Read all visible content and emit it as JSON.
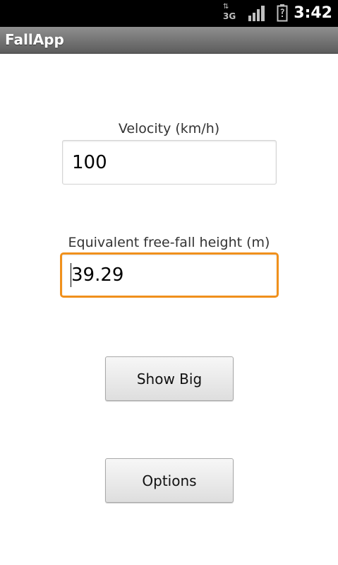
{
  "status_bar": {
    "network_type": "3G",
    "network_activity_arrows": "⇅",
    "signal_icon": "signal-bars-icon",
    "battery_icon": "battery-charging-icon",
    "time": "3:42"
  },
  "app": {
    "title": "FallApp"
  },
  "velocity": {
    "label": "Velocity (km/h)",
    "value": "100"
  },
  "height": {
    "label": "Equivalent free-fall height (m)",
    "value": "39.29",
    "focused": true
  },
  "buttons": {
    "show_big": "Show Big",
    "options": "Options"
  },
  "colors": {
    "focus_border": "#f0901c",
    "title_bar_top": "#8f8f8f",
    "title_bar_bottom": "#5c5c5c",
    "status_bar": "#000000"
  }
}
